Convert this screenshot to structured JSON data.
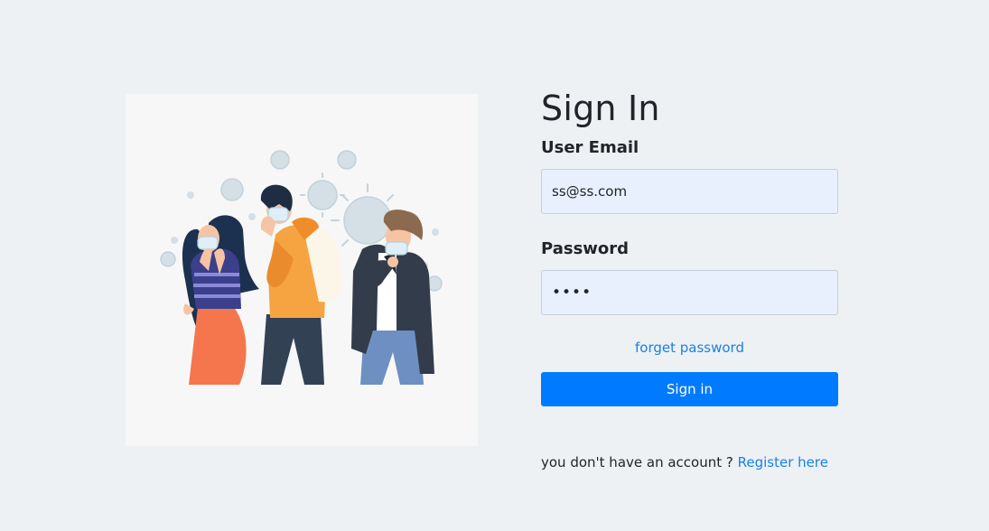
{
  "page": {
    "title": "Sign In"
  },
  "form": {
    "email_label": "User Email",
    "email_value": "ss@ss.com",
    "password_label": "Password",
    "password_value": "abcd",
    "forget_link": "forget password",
    "signin_button": "Sign in"
  },
  "footer": {
    "prompt": "you don't have an account ?",
    "register_link": "Register here"
  },
  "illustration": {
    "icon": "people-wearing-masks-illustration"
  },
  "colors": {
    "background": "#edf1f4",
    "primary": "#007bff",
    "link": "#1a80e5",
    "input_bg": "#e8f0fe"
  }
}
